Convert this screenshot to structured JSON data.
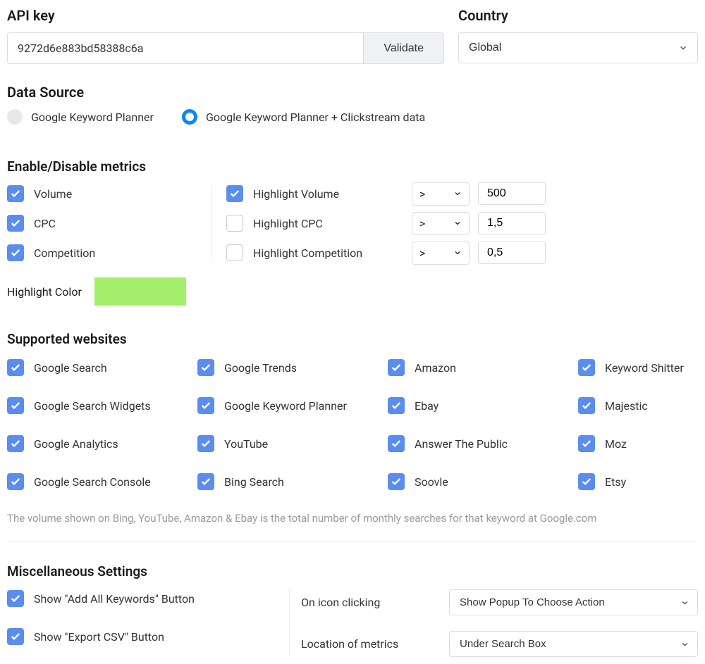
{
  "api": {
    "label": "API key",
    "value": "9272d6e883bd58388c6a",
    "validate_label": "Validate"
  },
  "country": {
    "label": "Country",
    "selected": "Global"
  },
  "data_source": {
    "label": "Data Source",
    "options": [
      {
        "label": "Google Keyword Planner",
        "selected": false
      },
      {
        "label": "Google Keyword Planner + Clickstream data",
        "selected": true
      }
    ]
  },
  "metrics": {
    "label": "Enable/Disable metrics",
    "list": [
      {
        "label": "Volume"
      },
      {
        "label": "CPC"
      },
      {
        "label": "Competition"
      }
    ],
    "highlights": [
      {
        "label": "Highlight Volume",
        "checked": true,
        "op": ">",
        "value": "500"
      },
      {
        "label": "Highlight CPC",
        "checked": false,
        "op": ">",
        "value": "1,5"
      },
      {
        "label": "Highlight Competition",
        "checked": false,
        "op": ">",
        "value": "0,5"
      }
    ],
    "highlight_color_label": "Highlight Color",
    "highlight_color": "#a3ef6b"
  },
  "websites": {
    "label": "Supported websites",
    "items": [
      "Google Search",
      "Google Trends",
      "Amazon",
      "Keyword Shitter",
      "Google Search Widgets",
      "Google Keyword Planner",
      "Ebay",
      "Majestic",
      "Google Analytics",
      "YouTube",
      "Answer The Public",
      "Moz",
      "Google Search Console",
      "Bing Search",
      "Soovle",
      "Etsy"
    ],
    "note": "The volume shown on Bing, YouTube, Amazon & Ebay is the total number of monthly searches for that keyword at Google.com"
  },
  "misc": {
    "label": "Miscellaneous Settings",
    "checks": [
      {
        "label": "Show \"Add All Keywords\" Button"
      },
      {
        "label": "Show \"Export CSV\" Button"
      }
    ],
    "settings": [
      {
        "label": "On icon clicking",
        "value": "Show Popup To Choose Action"
      },
      {
        "label": "Location of metrics",
        "value": "Under Search Box"
      }
    ]
  }
}
